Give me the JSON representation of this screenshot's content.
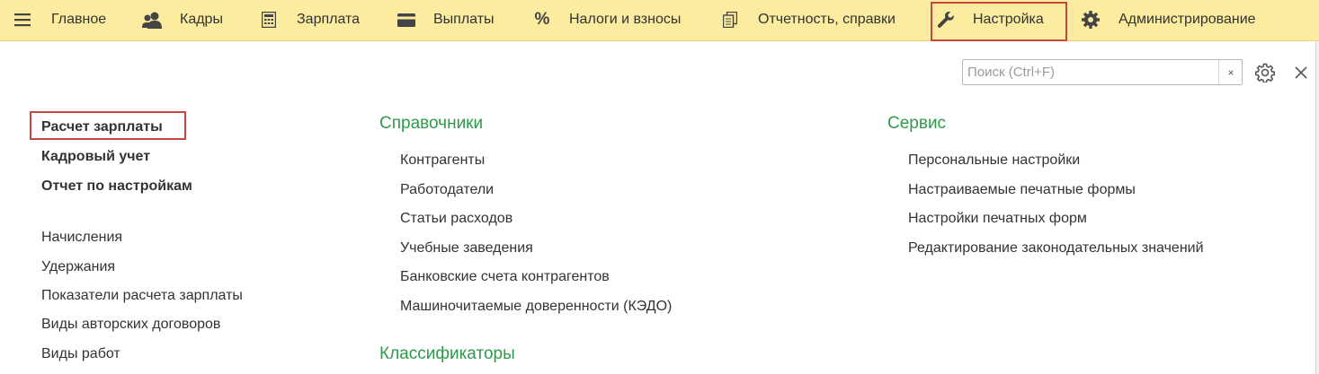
{
  "nav": {
    "items": [
      {
        "label": "Главное",
        "icon": "menu-icon"
      },
      {
        "label": "Кадры",
        "icon": "people-icon"
      },
      {
        "label": "Зарплата",
        "icon": "calculator-icon"
      },
      {
        "label": "Выплаты",
        "icon": "card-icon"
      },
      {
        "label": "Налоги и взносы",
        "icon": "percent-icon"
      },
      {
        "label": "Отчетность, справки",
        "icon": "documents-icon"
      },
      {
        "label": "Настройка",
        "icon": "wrench-icon"
      },
      {
        "label": "Администрирование",
        "icon": "gear-icon"
      }
    ],
    "active_index": 6
  },
  "search": {
    "placeholder": "Поиск (Ctrl+F)",
    "value": "",
    "clear_label": "×"
  },
  "left_column": {
    "primary": [
      "Расчет зарплаты",
      "Кадровый учет",
      "Отчет по настройкам"
    ],
    "items": [
      "Начисления",
      "Удержания",
      "Показатели расчета зарплаты",
      "Виды авторских договоров",
      "Виды работ"
    ]
  },
  "middle_column": {
    "title": "Справочники",
    "items": [
      "Контрагенты",
      "Работодатели",
      "Статьи расходов",
      "Учебные заведения",
      "Банковские счета контрагентов",
      "Машиночитаемые доверенности (КЭДО)"
    ],
    "title2": "Классификаторы"
  },
  "right_column": {
    "title": "Сервис",
    "items": [
      "Персональные настройки",
      "Настраиваемые печатные формы",
      "Настройки печатных форм",
      "Редактирование законодательных значений"
    ]
  },
  "colors": {
    "accent_green": "#2e9a4b",
    "topbar_bg": "#fbec9f",
    "highlight_red": "#c9463e"
  }
}
